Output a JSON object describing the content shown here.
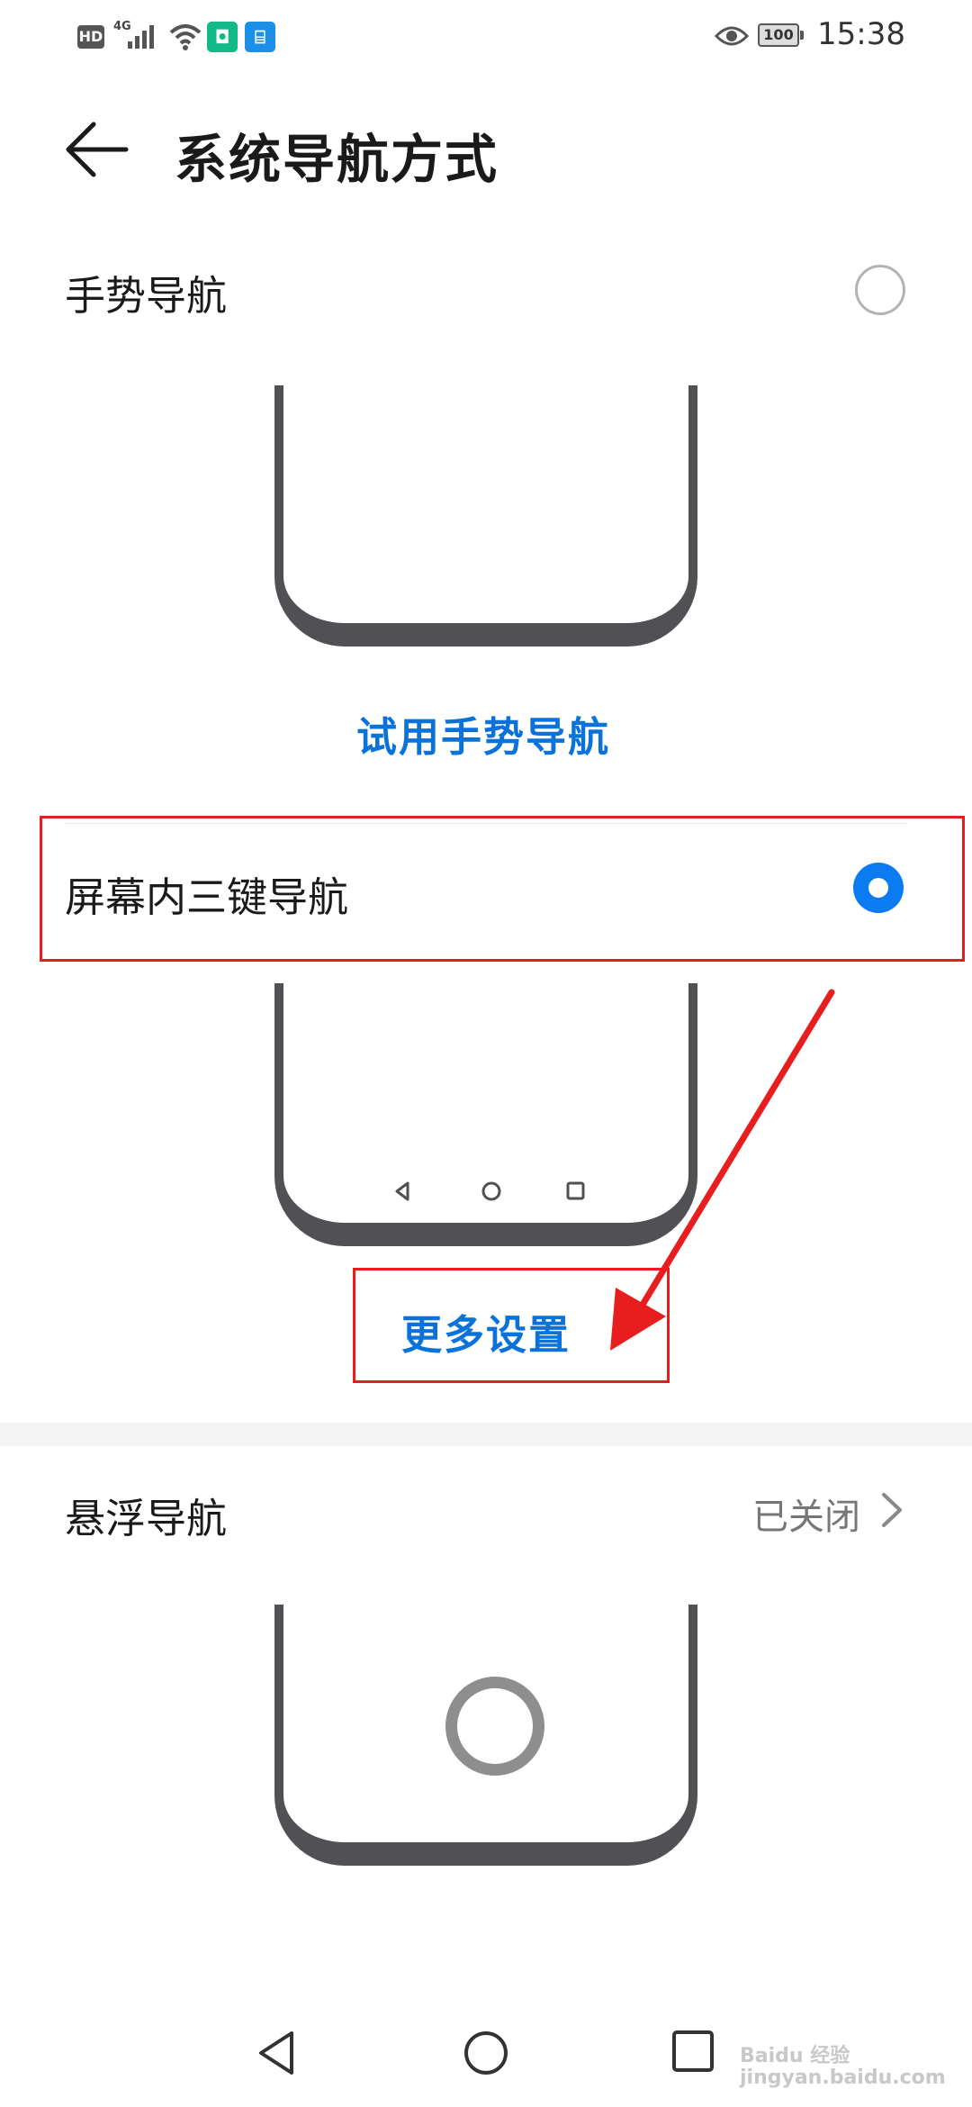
{
  "status_bar": {
    "hd_label": "HD",
    "network_type": "4G",
    "battery_level": "100",
    "time": "15:38",
    "icons": [
      "signal-icon",
      "wifi-icon",
      "app-notification-icon",
      "app-notification-icon",
      "eye-comfort-icon",
      "battery-icon"
    ]
  },
  "header": {
    "title": "系统导航方式",
    "back_icon": "back-arrow-icon"
  },
  "options": {
    "gesture": {
      "label": "手势导航",
      "selected": false,
      "link": "试用手势导航"
    },
    "three_key": {
      "label": "屏幕内三键导航",
      "selected": true,
      "link": "更多设置"
    },
    "floating": {
      "label": "悬浮导航",
      "status": "已关闭"
    }
  },
  "colors": {
    "accent": "#0a72d8",
    "radio_selected": "#0a7bf0",
    "annotation_red": "#e81e1e",
    "frame": "#505055"
  },
  "system_nav": [
    "back-triangle-icon",
    "home-circle-icon",
    "recents-square-icon"
  ],
  "watermark": "Baidu 经验 jingyan.baidu.com"
}
